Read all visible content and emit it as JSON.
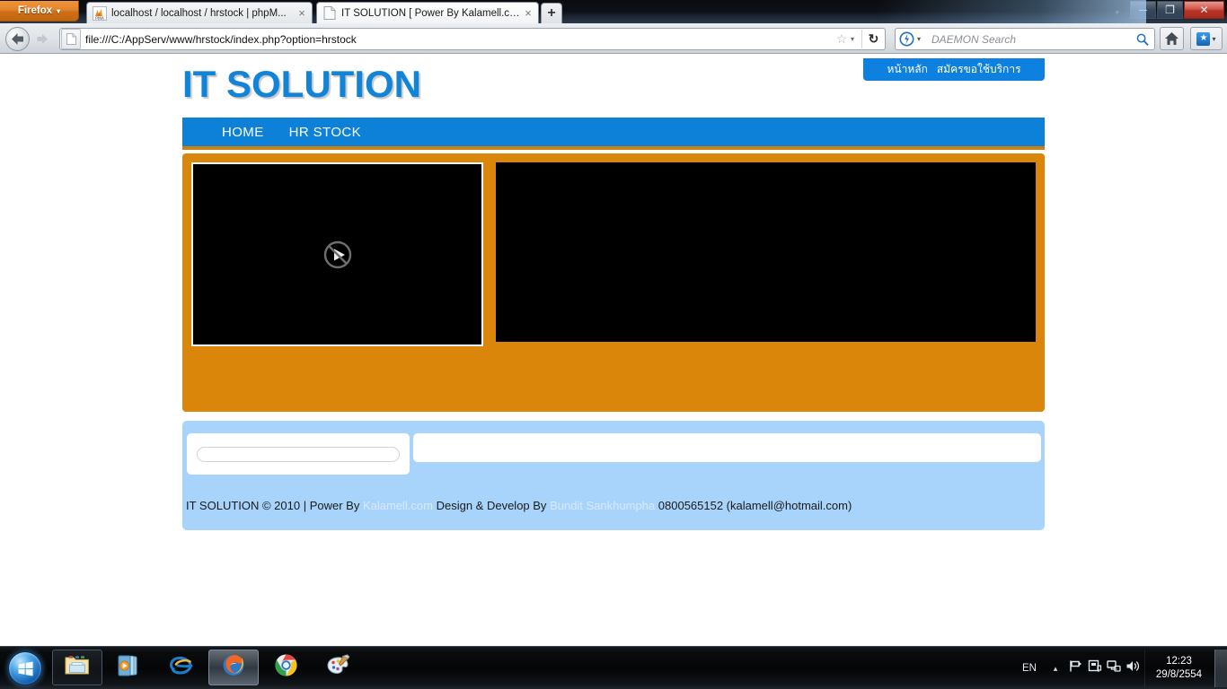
{
  "browser": {
    "app_button": "Firefox",
    "tabs": [
      {
        "title": "localhost / localhost / hrstock | phpM...",
        "favicon": "phpmyadmin-icon",
        "active": false,
        "close": "×"
      },
      {
        "title": "IT SOLUTION [ Power By Kalamell.co...",
        "favicon": "page-icon",
        "active": true,
        "close": "×"
      }
    ],
    "new_tab_label": "+",
    "window_controls": {
      "minimize": "─",
      "maximize": "❐",
      "close": "✕"
    },
    "url": "file:///C:/AppServ/www/hrstock/index.php?option=hrstock",
    "reload_glyph": "↻",
    "star_glyph": "☆",
    "caret_glyph": "▾",
    "search": {
      "engine": "daemon-search-icon",
      "placeholder": "DAEMON Search",
      "value": ""
    },
    "home_title": "Home",
    "bookmarks_title": "Bookmarks"
  },
  "page": {
    "logo": "IT SOLUTION",
    "top_nav": [
      {
        "label": "หน้าหลัก"
      },
      {
        "label": "สมัครขอใช้บริการ"
      }
    ],
    "main_nav": [
      {
        "label": "HOME"
      },
      {
        "label": "HR STOCK"
      }
    ],
    "media": {
      "left_placeholder_icon": "blocked-plugin-play-icon",
      "right_placeholder_icon": "empty-media-box"
    },
    "form": {
      "login_input_value": "",
      "login_input_placeholder": ""
    },
    "footer": {
      "prefix": "IT SOLUTION © 2010 | Power By ",
      "link1": "Kalamell.com",
      "middle": " Design & Develop By ",
      "link2": "Bundit Sankhumpha",
      "suffix": " 0800565152 (kalamell@hotmail.com)"
    },
    "colors": {
      "brand_blue": "#0d80d8",
      "orange": "#d9860b",
      "light_blue": "#a8d4fb",
      "footer_link": "#d9e9fb"
    }
  },
  "taskbar": {
    "start": "start-orb",
    "items": [
      {
        "name": "windows-explorer-icon",
        "active": false
      },
      {
        "name": "windows-media-player-icon",
        "active": false
      },
      {
        "name": "internet-explorer-icon",
        "active": false
      },
      {
        "name": "firefox-icon",
        "active": true
      },
      {
        "name": "google-chrome-icon",
        "active": false
      },
      {
        "name": "ms-paint-icon",
        "active": false
      }
    ],
    "tray": {
      "language": "EN",
      "chevron": "▴",
      "icons": [
        "flag-action-center-icon",
        "action-center-icon",
        "network-icon",
        "volume-icon"
      ],
      "time": "12:23",
      "date": "29/8/2554"
    }
  }
}
